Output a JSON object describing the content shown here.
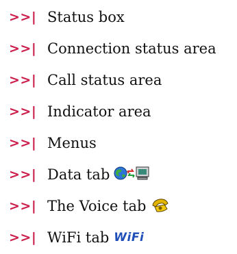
{
  "marker": ">>|",
  "colors": {
    "marker": "#cc1f4d",
    "text": "#111111",
    "wifi": "#1e4fb8"
  },
  "items": [
    {
      "label": "Status box"
    },
    {
      "label": "Connection status area"
    },
    {
      "label": "Call status area"
    },
    {
      "label": "Indicator area"
    },
    {
      "label": "Menus"
    },
    {
      "label": "Data tab",
      "icon": "globe-computer-transfer-icon"
    },
    {
      "label": "The Voice tab",
      "icon": "phone-handset-icon"
    },
    {
      "label": "WiFi tab",
      "icon_text": "WiFi"
    }
  ]
}
